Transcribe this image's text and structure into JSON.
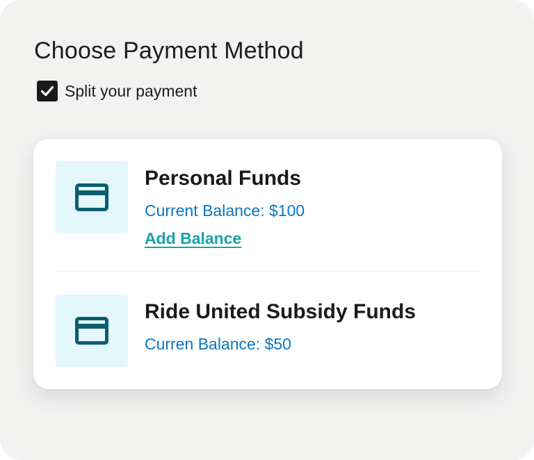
{
  "header": {
    "title": "Choose Payment Method"
  },
  "split_payment": {
    "label": "Split your payment",
    "checked": true
  },
  "funds": [
    {
      "name": "Personal Funds",
      "balance_text": "Current Balance: $100",
      "action_label": "Add Balance",
      "icon": "credit-card-icon"
    },
    {
      "name": "Ride United Subsidy Funds",
      "balance_text": "Curren Balance: $50",
      "icon": "credit-card-icon"
    }
  ],
  "colors": {
    "background": "#f2f2f1",
    "card": "#ffffff",
    "icon_bg": "#e3f7fd",
    "icon": "#0b5e6e",
    "balance_text": "#0a76c2",
    "link": "#17a3a8",
    "checkbox": "#1a1a1a"
  }
}
